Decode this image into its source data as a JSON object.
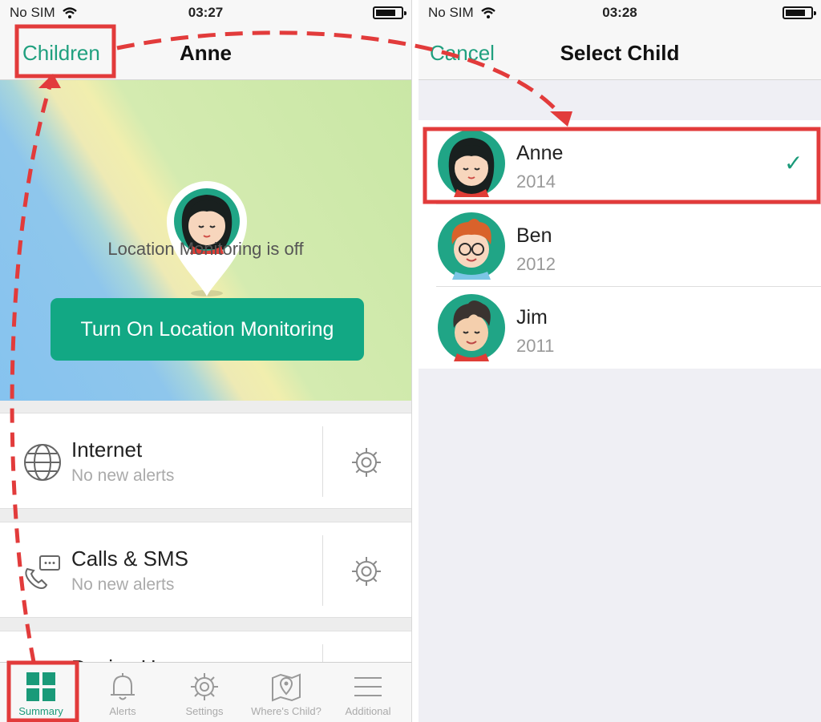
{
  "left_screen": {
    "status_bar": {
      "carrier": "No SIM",
      "time": "03:27"
    },
    "nav": {
      "back_label": "Children",
      "title": "Anne"
    },
    "map": {
      "message": "Location Monitoring is off",
      "button_label": "Turn On Location Monitoring"
    },
    "cards": [
      {
        "title": "Internet",
        "subtitle": "No new alerts",
        "icon": "globe-icon"
      },
      {
        "title": "Calls & SMS",
        "subtitle": "No new alerts",
        "icon": "phone-message-icon"
      },
      {
        "title": "Device U",
        "subtitle": "",
        "icon": "device-icon"
      }
    ],
    "tabs": [
      {
        "label": "Summary",
        "icon": "summary-grid-icon",
        "active": true
      },
      {
        "label": "Alerts",
        "icon": "bell-icon",
        "active": false
      },
      {
        "label": "Settings",
        "icon": "gear-icon",
        "active": false
      },
      {
        "label": "Where's Child?",
        "icon": "map-pin-icon",
        "active": false
      },
      {
        "label": "Additional",
        "icon": "menu-icon",
        "active": false
      }
    ]
  },
  "right_screen": {
    "status_bar": {
      "carrier": "No SIM",
      "time": "03:28"
    },
    "nav": {
      "cancel_label": "Cancel",
      "title": "Select Child"
    },
    "children": [
      {
        "name": "Anne",
        "year": "2014",
        "selected": true,
        "checkmark": "✓"
      },
      {
        "name": "Ben",
        "year": "2012",
        "selected": false
      },
      {
        "name": "Jim",
        "year": "2011",
        "selected": false
      }
    ]
  },
  "colors": {
    "accent": "#12a884",
    "highlight": "#e23b3b"
  }
}
